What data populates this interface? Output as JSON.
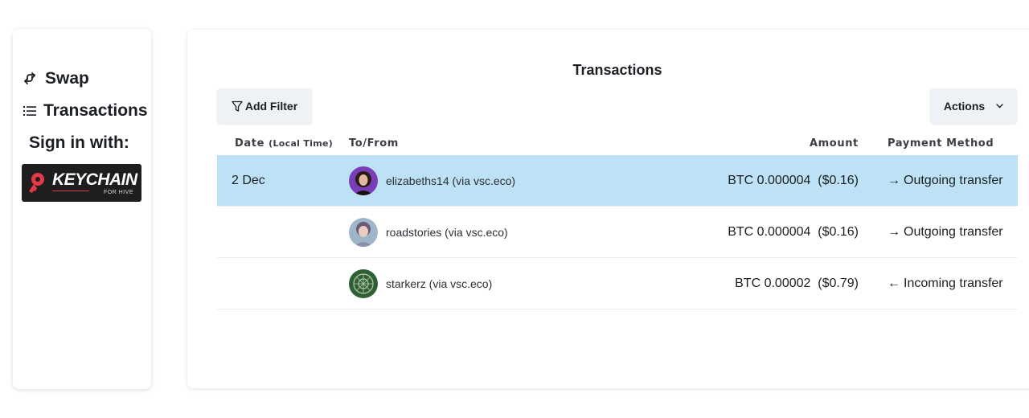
{
  "sidebar": {
    "swap_label": "Swap",
    "transactions_label": "Transactions",
    "signin_label": "Sign in with:",
    "keychain": {
      "word": "KEYCHAIN",
      "sub": "FOR HIVE"
    }
  },
  "main": {
    "title": "Transactions",
    "add_filter_label": "Add Filter",
    "actions_label": "Actions",
    "columns": {
      "date": "Date",
      "date_note": "(Local Time)",
      "to_from": "To/From",
      "amount": "Amount",
      "payment_method": "Payment Method"
    },
    "rows": [
      {
        "date": "2 Dec",
        "name": "elizabeths14 (via vsc.eco)",
        "amount": "BTC 0.000004  ($0.16)",
        "direction": "→",
        "method": "Outgoing transfer",
        "selected": true
      },
      {
        "date": "",
        "name": "roadstories (via vsc.eco)",
        "amount": "BTC 0.000004  ($0.16)",
        "direction": "→",
        "method": "Outgoing transfer",
        "selected": false
      },
      {
        "date": "",
        "name": "starkerz (via vsc.eco)",
        "amount": "BTC 0.00002  ($0.79)",
        "direction": "←",
        "method": "Incoming transfer",
        "selected": false
      }
    ]
  },
  "colors": {
    "selected_row": "#bde1f5",
    "button_bg": "#eef1f5",
    "keychain_bg": "#1e1e1e",
    "keychain_accent": "#e63946"
  },
  "icons": {
    "swap": "swap-arrows-icon",
    "transactions": "list-icon",
    "filter": "funnel-icon",
    "actions": "chevron-down-icon"
  }
}
